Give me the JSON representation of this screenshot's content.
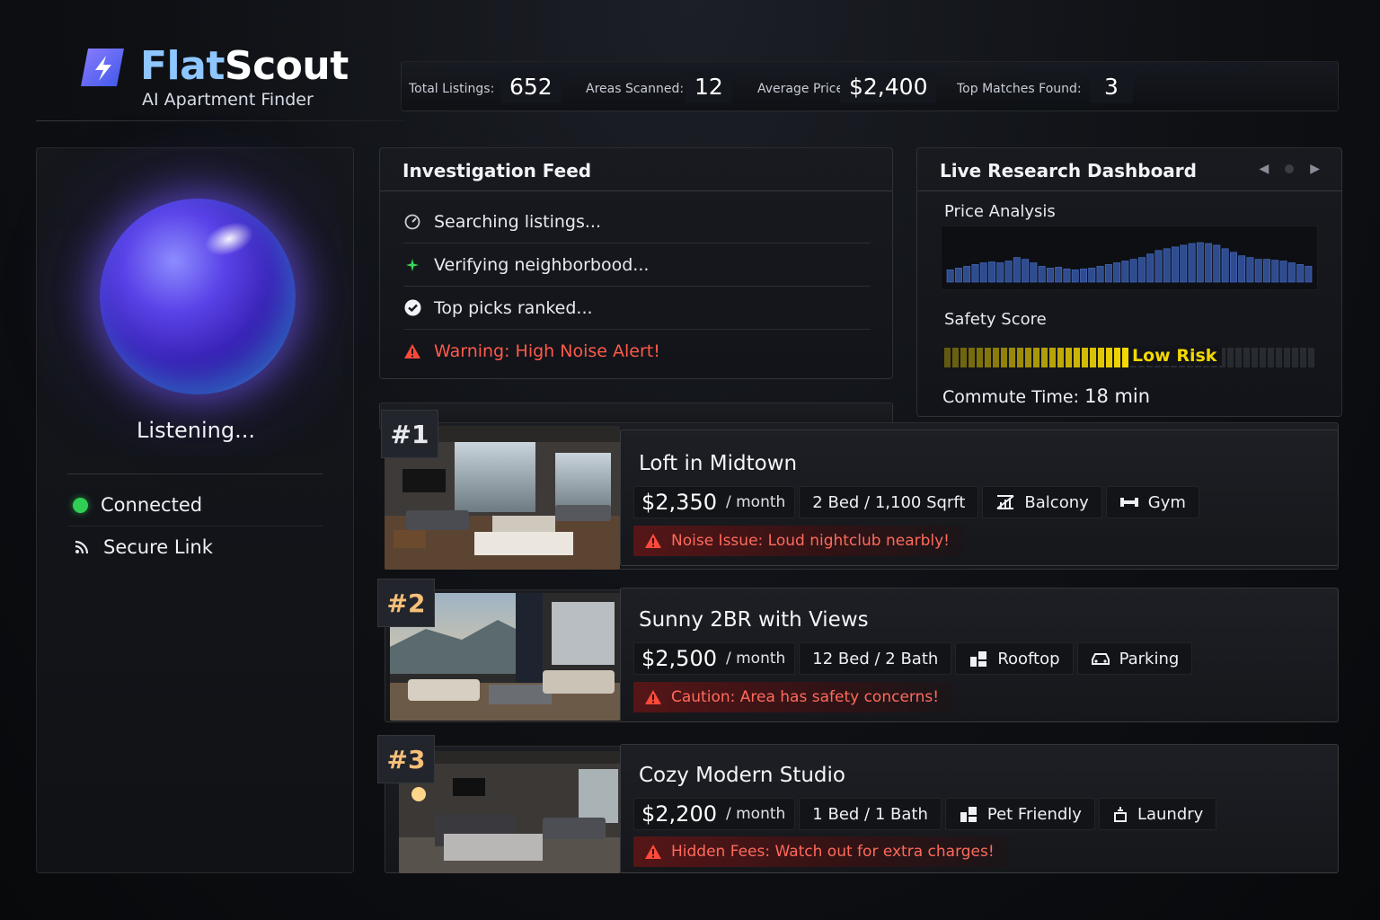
{
  "brand": {
    "name_part1": "Flat",
    "name_part2": "Scout",
    "subtitle": "AI Apartment Finder"
  },
  "stats": [
    {
      "label": "Total Listings:",
      "value": "652"
    },
    {
      "label": "Areas Scanned:",
      "value": "12"
    },
    {
      "label": "Average Price",
      "value": "$2,400"
    },
    {
      "label": "Top Matches Found:",
      "value": "3"
    }
  ],
  "assistant": {
    "status_text": "Listening...",
    "connection": [
      {
        "label": "Connected",
        "icon": "green-dot-icon"
      },
      {
        "label": "Secure Link",
        "icon": "signal-icon"
      }
    ]
  },
  "feed": {
    "title": "Investigation Feed",
    "items": [
      {
        "text": "Searching listings...",
        "icon": "gauge-icon"
      },
      {
        "text": "Verifying neighborbood...",
        "icon": "sparkle-icon"
      },
      {
        "text": "Top picks ranked...",
        "icon": "check-circle-icon"
      },
      {
        "text": "Warning: High Noise Alert!",
        "icon": "warning-icon"
      }
    ]
  },
  "dashboard": {
    "title": "Live Research Dashboard",
    "price_label": "Price Analysis",
    "price_bars": [
      14,
      16,
      18,
      20,
      22,
      23,
      22,
      24,
      28,
      26,
      22,
      18,
      16,
      17,
      15,
      14,
      15,
      16,
      18,
      20,
      22,
      24,
      26,
      28,
      32,
      36,
      38,
      40,
      42,
      44,
      45,
      44,
      42,
      38,
      34,
      30,
      28,
      26,
      26,
      25,
      24,
      22,
      20,
      18
    ],
    "safety_label": "Safety Score",
    "safety_level": 0.48,
    "safety_text": "Low Risk",
    "commute_label": "Commute Time:",
    "commute_value": "18 min",
    "accent_color": "#f5d800"
  },
  "listings": [
    {
      "rank": "#1",
      "title": "Loft in Midtown",
      "price": "$2,350",
      "per": "/ month",
      "chips": [
        {
          "text": "2  Bed  /   1,100  Sqrft",
          "icon": ""
        },
        {
          "text": "Balcony",
          "icon": "balcony-icon"
        },
        {
          "text": "Gym",
          "icon": "gym-icon"
        }
      ],
      "alert": "Noise Issue: Loud nightclub nearbly!"
    },
    {
      "rank": "#2",
      "title": "Sunny 2BR with Views",
      "price": "$2,500",
      "per": "/ month",
      "chips": [
        {
          "text": "12  Bed  /   2  Bath",
          "icon": ""
        },
        {
          "text": "Rooftop",
          "icon": "rooftop-icon"
        },
        {
          "text": "Parking",
          "icon": "parking-icon"
        }
      ],
      "alert": "Caution: Area has safety concerns!"
    },
    {
      "rank": "#3",
      "title": "Cozy Modern Studio",
      "price": "$2,200",
      "per": "/ month",
      "chips": [
        {
          "text": "1  Bed  /   1  Bath",
          "icon": ""
        },
        {
          "text": "Pet Friendly",
          "icon": "pet-icon"
        },
        {
          "text": "Laundry",
          "icon": "laundry-icon"
        }
      ],
      "alert": "Hidden Fees: Watch out for extra charges!"
    }
  ]
}
